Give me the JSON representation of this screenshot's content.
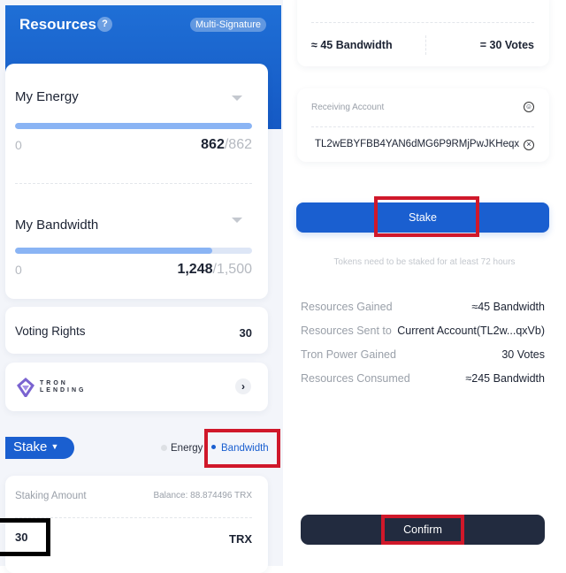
{
  "header": {
    "title": "Resources",
    "help_icon": "question-icon",
    "multisig_label": "Multi-Signature",
    "color": "#1a63d0"
  },
  "energy": {
    "title": "My Energy",
    "min": "0",
    "current": "862",
    "max": "862",
    "fill_fraction": 1.0
  },
  "bandwidth": {
    "title": "My Bandwidth",
    "min": "0",
    "current": "1,248",
    "max": "1,500",
    "fill_fraction": 0.832
  },
  "voting": {
    "label": "Voting Rights",
    "value": "30"
  },
  "lending": {
    "logo_text_top": "TRON",
    "logo_text_bottom": "LENDING"
  },
  "stake_form": {
    "mode_label": "Stake",
    "options": [
      "Energy",
      "Bandwidth"
    ],
    "selected": "Bandwidth",
    "amount_label": "Staking Amount",
    "balance": "Balance: 88.874496 TRX",
    "amount": "30",
    "unit": "TRX"
  },
  "estimate": {
    "bandwidth": "≈ 45 Bandwidth",
    "votes": "= 30 Votes"
  },
  "receiving": {
    "label": "Receiving Account",
    "address": "TL2wEBYFBB4YAN6dMG6P9RMjPwJKHeqx"
  },
  "stake_button": "Stake",
  "note": "Tokens need to be staked for at least 72 hours",
  "summary": [
    {
      "label": "Resources Gained",
      "value": "≈45 Bandwidth"
    },
    {
      "label": "Resources Sent to",
      "value": "Current Account(TL2w...qxVb)"
    },
    {
      "label": "Tron Power Gained",
      "value": "30 Votes"
    },
    {
      "label": "Resources Consumed",
      "value": "≈245 Bandwidth"
    }
  ],
  "confirm_button": "Confirm",
  "colors": {
    "accent": "#1a5fd0",
    "confirm": "#222b3f",
    "highlight": "#d0182a"
  }
}
